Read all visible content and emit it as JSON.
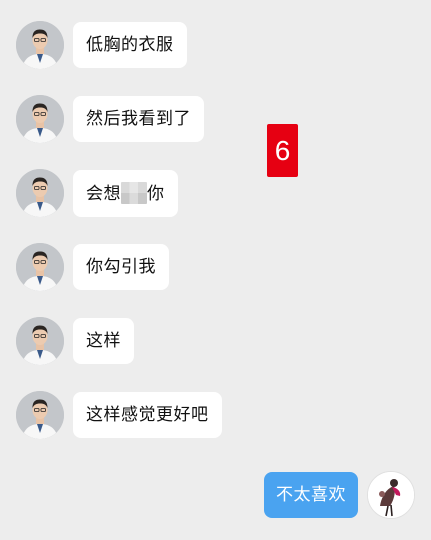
{
  "messages": [
    {
      "text": "低胸的衣服"
    },
    {
      "text": "然后我看到了"
    },
    {
      "text_before": "会想",
      "text_after": "你"
    },
    {
      "text": "你勾引我"
    },
    {
      "text": "这样"
    },
    {
      "text": "这样感觉更好吧"
    }
  ],
  "reply": {
    "text": "不太喜欢"
  },
  "badge": {
    "text": "6"
  },
  "colors": {
    "background": "#ededed",
    "incoming_bubble": "#ffffff",
    "outgoing_bubble": "#4aa3f0",
    "badge": "#e60012"
  },
  "icons": {
    "incoming_avatar": "doctor-avatar-icon",
    "outgoing_avatar": "user-avatar-icon"
  }
}
